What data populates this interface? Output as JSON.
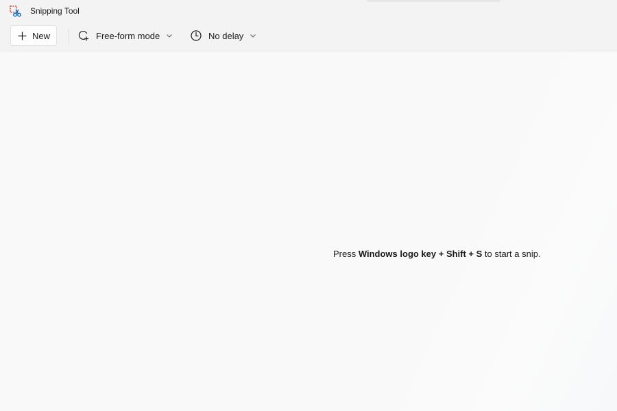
{
  "window": {
    "title": "Snipping Tool"
  },
  "toolbar": {
    "new_label": "New",
    "mode_label": "Free-form mode",
    "delay_label": "No delay"
  },
  "main": {
    "hint_prefix": "Press ",
    "hint_keys": "Windows logo key + Shift + S",
    "hint_suffix": " to start a snip."
  },
  "icons": {
    "app": "snipping-tool-icon",
    "new": "plus-icon",
    "mode": "free-form-lasso-icon",
    "delay": "clock-icon",
    "chevron": "chevron-down-icon"
  },
  "colors": {
    "accent_blue": "#0067c0",
    "app_icon_red": "#e0483e"
  }
}
